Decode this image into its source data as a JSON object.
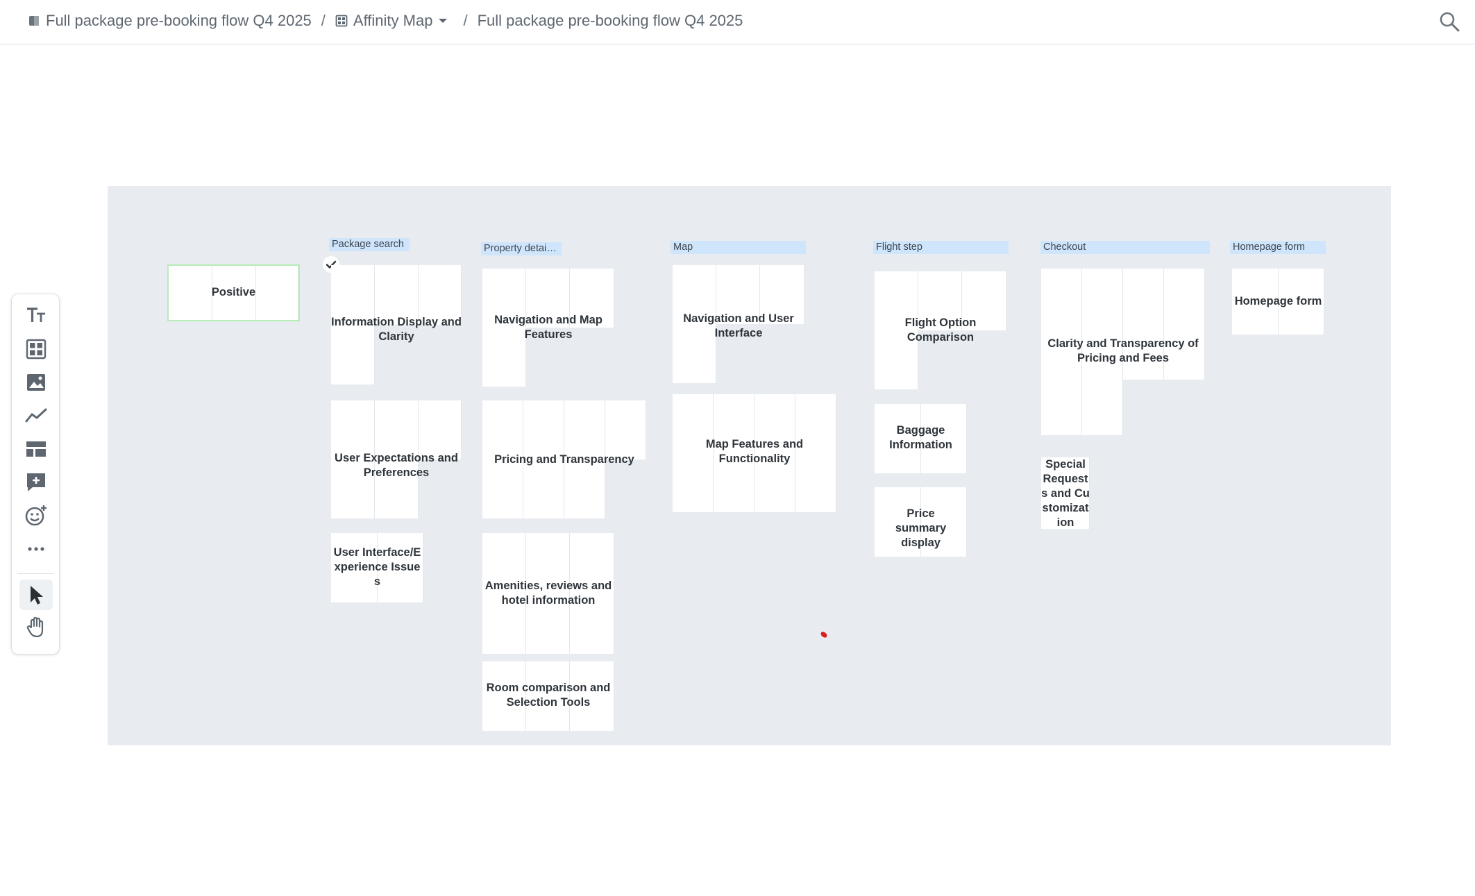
{
  "breadcrumb": {
    "project": "Full package pre-booking flow Q4 2025",
    "view": "Affinity Map",
    "board": "Full package pre-booking flow Q4 2025",
    "separator": "/"
  },
  "lanes": [
    {
      "label": "Package search"
    },
    {
      "label": "Property detai…"
    },
    {
      "label": "Map"
    },
    {
      "label": "Flight step"
    },
    {
      "label": "Checkout"
    },
    {
      "label": "Homepage form"
    }
  ],
  "clusters": {
    "positive": "Positive",
    "info_display": "Information Display and Clarity",
    "user_expectations": "User Expectations and Preferences",
    "ui_issues": "User Interface/Experience Issues",
    "nav_map_features": "Navigation and Map Features",
    "pricing_transparency": "Pricing and Transparency",
    "amenities": "Amenities, reviews and hotel information",
    "room_comparison": "Room comparison and Selection Tools",
    "nav_ui": "Navigation and User Interface",
    "map_features": "Map Features and Functionality",
    "flight_option": "Flight Option Comparison",
    "baggage": "Baggage Information",
    "price_summary": "Price summary display",
    "clarity_pricing_fees": "Clarity and Transparency of Pricing and Fees",
    "special_requests": "Special Requests and Customization",
    "homepage_form": "Homepage form"
  },
  "icons": {
    "project": "document-icon",
    "view": "grid-icon",
    "search": "search-icon"
  },
  "colors": {
    "lane_label_bg": "#cfe5fb",
    "board_bg": "#e8ecf0",
    "positive_border": "#b6ecb6"
  }
}
